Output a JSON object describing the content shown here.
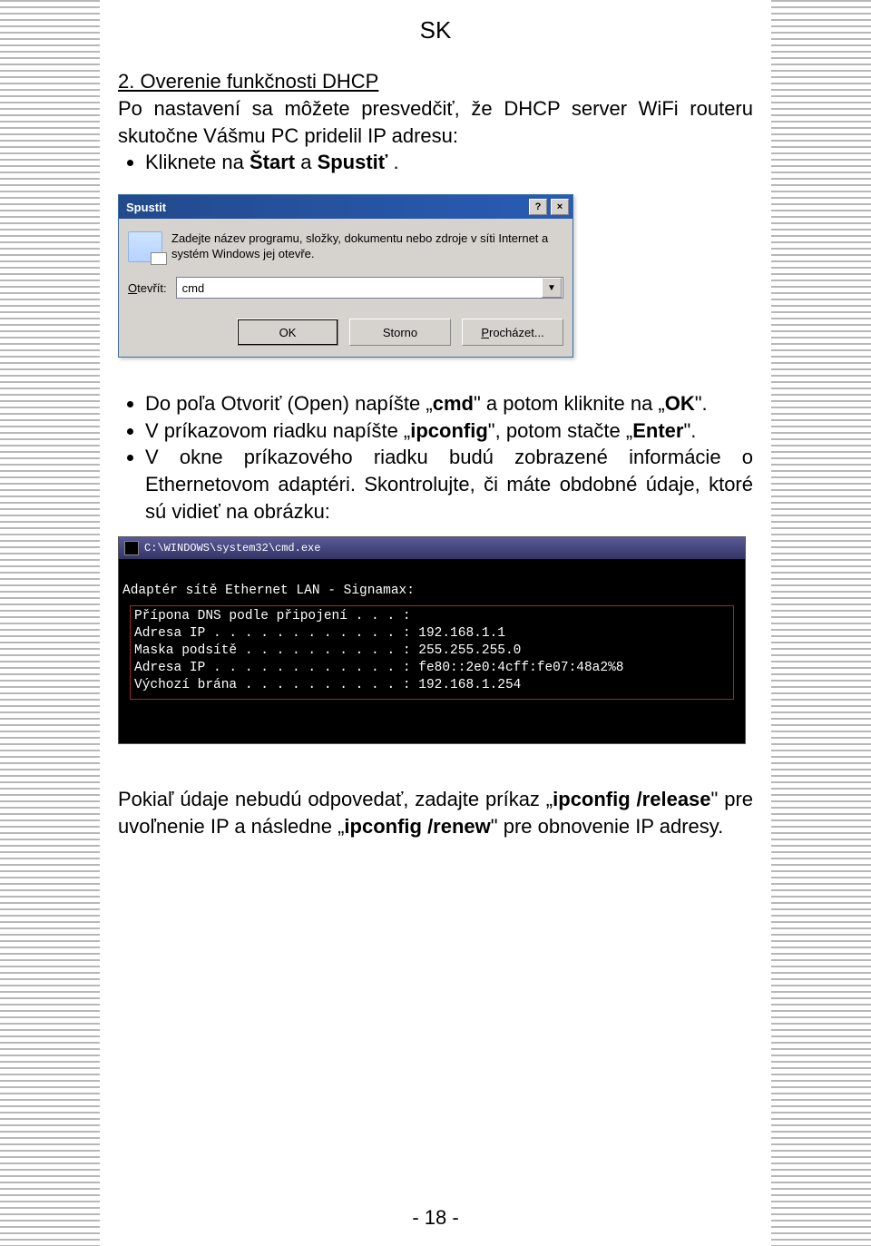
{
  "page_header": "SK",
  "section_heading": "2. Overenie funkčnosti DHCP",
  "intro_text": "Po nastavení sa môžete presvedčiť, že DHCP server WiFi routeru skutočne Vášmu PC pridelil IP adresu:",
  "bullet1_prefix": "Kliknete na ",
  "bullet1_bold1": "Štart",
  "bullet1_mid": " a ",
  "bullet1_bold2": "Spustiť",
  "bullet1_suffix": " .",
  "dialog": {
    "title": "Spustit",
    "help_btn": "?",
    "close_btn": "×",
    "desc": "Zadejte název programu, složky, dokumentu nebo zdroje v síti Internet a systém Windows jej otevře.",
    "open_label_u": "O",
    "open_label_rest": "tevřít:",
    "input_value": "cmd",
    "btn_ok": "OK",
    "btn_cancel": "Storno",
    "btn_browse": "Procházet..."
  },
  "bullet2_p1": "Do poľa Otvoriť (Open) napíšte „",
  "bullet2_b1": "cmd",
  "bullet2_p2": "\" a potom kliknite na „",
  "bullet2_b2": "OK",
  "bullet2_p3": "\".",
  "bullet3_p1": "V príkazovom riadku napíšte „",
  "bullet3_b1": "ipconfig",
  "bullet3_p2": "\", potom stačte „",
  "bullet3_b2": "Enter",
  "bullet3_p3": "\".",
  "bullet4": "V okne príkazového riadku budú zobrazené informácie o Ethernetovom adaptéri. Skontrolujte, či máte obdobné údaje, ktoré sú vidieť na obrázku:",
  "cmd": {
    "title": "C:\\WINDOWS\\system32\\cmd.exe",
    "line1": "Adaptér sítě Ethernet LAN - Signamax:",
    "box_l1": "Přípona DNS podle připojení . . . :",
    "box_l2": "Adresa IP . . . . . . . . . . . . : 192.168.1.1",
    "box_l3": "Maska podsítě . . . . . . . . . . : 255.255.255.0",
    "box_l4": "Adresa IP . . . . . . . . . . . . : fe80::2e0:4cff:fe07:48a2%8",
    "box_l5": "Výchozí brána . . . . . . . . . . : 192.168.1.254"
  },
  "outro_p1": "Pokiaľ údaje nebudú odpovedať, zadajte príkaz „",
  "outro_b1": "ipconfig /release",
  "outro_p2": "\" pre uvoľnenie IP a následne „",
  "outro_b2": "ipconfig /renew",
  "outro_p3": "\" pre obnovenie IP adresy.",
  "page_number": "- 18 -"
}
